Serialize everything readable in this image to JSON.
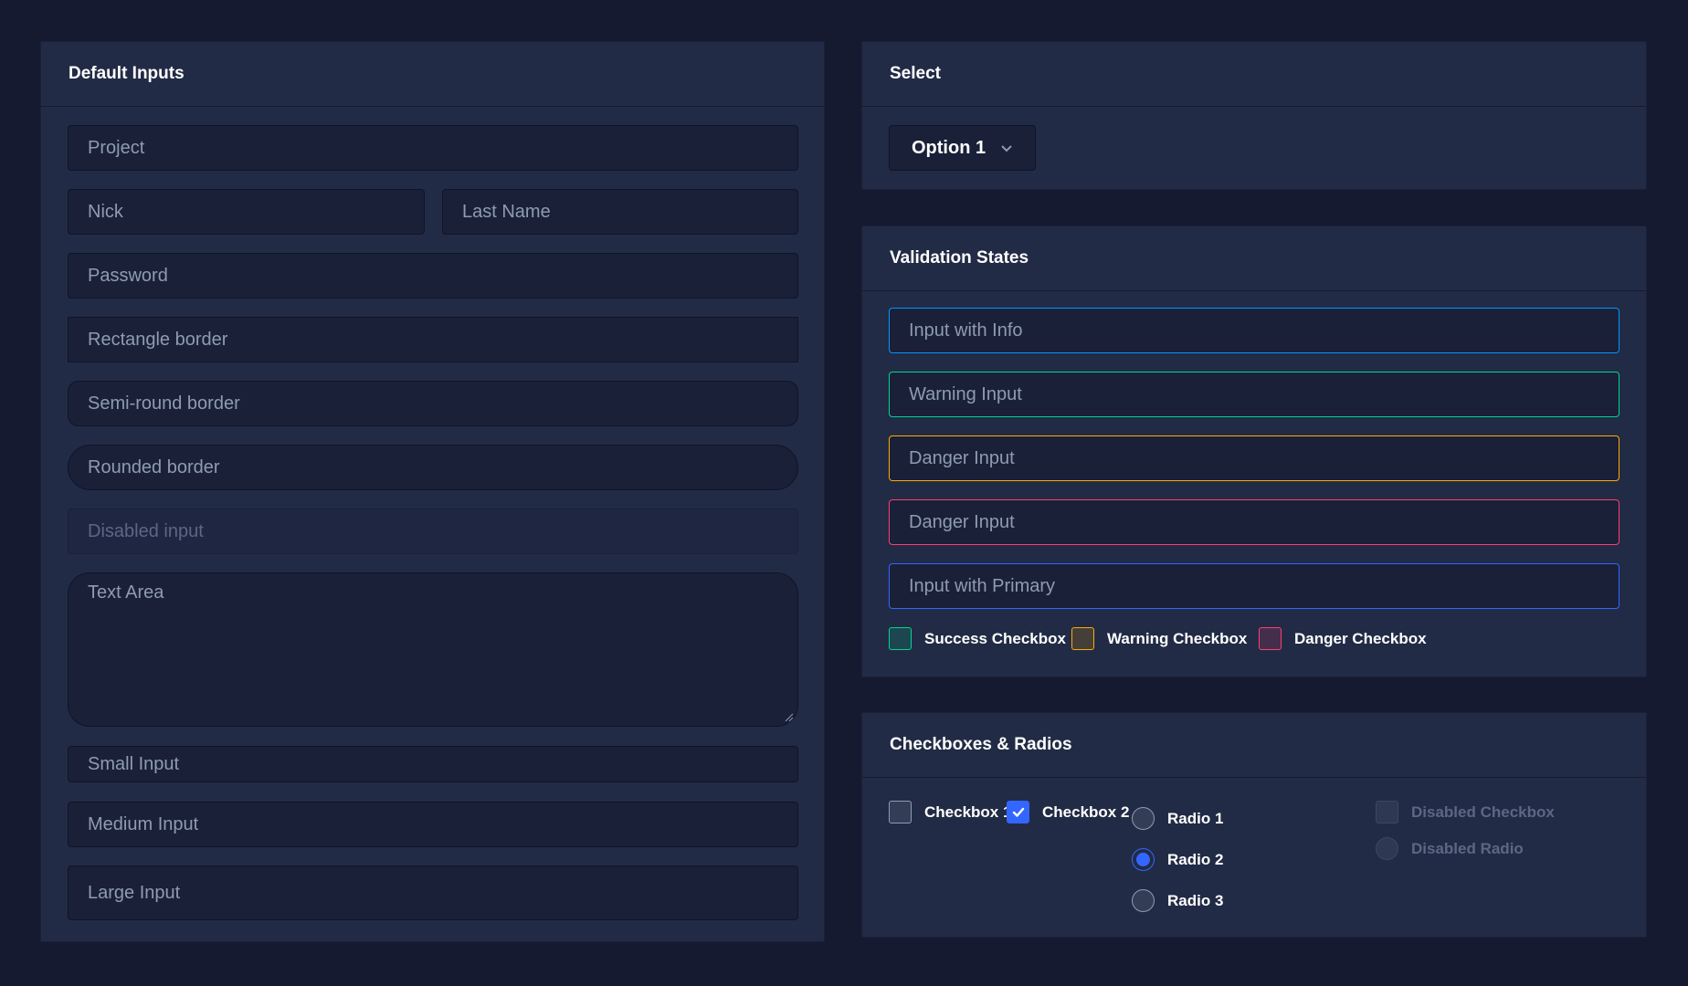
{
  "default_inputs": {
    "title": "Default Inputs",
    "project_placeholder": "Project",
    "nick_placeholder": "Nick",
    "last_name_placeholder": "Last Name",
    "password_placeholder": "Password",
    "rectangle_placeholder": "Rectangle border",
    "semi_round_placeholder": "Semi-round border",
    "rounded_placeholder": "Rounded border",
    "disabled_placeholder": "Disabled input",
    "textarea_placeholder": "Text Area",
    "small_placeholder": "Small Input",
    "medium_placeholder": "Medium Input",
    "large_placeholder": "Large Input"
  },
  "select": {
    "title": "Select",
    "selected_value": "Option 1"
  },
  "validation": {
    "title": "Validation States",
    "info_placeholder": "Input with Info",
    "warning_placeholder": "Warning Input",
    "danger_placeholder_1": "Danger Input",
    "danger_placeholder_2": "Danger Input",
    "primary_placeholder": "Input with Primary",
    "success_checkbox": "Success Checkbox",
    "warning_checkbox": "Warning Checkbox",
    "danger_checkbox": "Danger Checkbox"
  },
  "checkboxes_radios": {
    "title": "Checkboxes & Radios",
    "checkbox_1": "Checkbox 1",
    "checkbox_2": "Checkbox 2",
    "radio_1": "Radio 1",
    "radio_2": "Radio 2",
    "radio_3": "Radio 3",
    "disabled_checkbox": "Disabled Checkbox",
    "disabled_radio": "Disabled Radio"
  },
  "colors": {
    "background": "#151a30",
    "card": "#222b45",
    "input": "#192038",
    "info": "#0095ff",
    "success": "#00d68f",
    "warning": "#ffaa00",
    "danger": "#ff3d71",
    "primary": "#3366ff"
  }
}
